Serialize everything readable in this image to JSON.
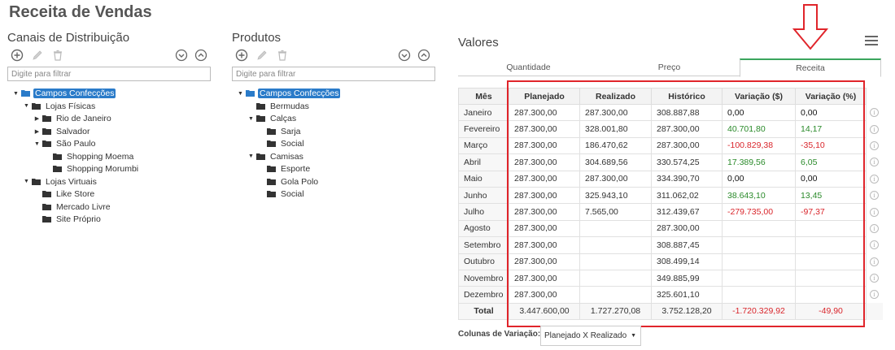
{
  "page_title": "Receita de Vendas",
  "channels": {
    "title": "Canais de Distribuição",
    "filter_placeholder": "Digite para filtrar",
    "tree": [
      {
        "label": "Campos Confecções",
        "depth": 0,
        "expanded": true,
        "selected": true
      },
      {
        "label": "Lojas Físicas",
        "depth": 1,
        "expanded": true
      },
      {
        "label": "Rio de Janeiro",
        "depth": 2,
        "expanded": false
      },
      {
        "label": "Salvador",
        "depth": 2,
        "expanded": false
      },
      {
        "label": "São Paulo",
        "depth": 2,
        "expanded": true
      },
      {
        "label": "Shopping Moema",
        "depth": 3,
        "leaf": true
      },
      {
        "label": "Shopping Morumbi",
        "depth": 3,
        "leaf": true
      },
      {
        "label": "Lojas Virtuais",
        "depth": 1,
        "expanded": true
      },
      {
        "label": "Like Store",
        "depth": 2,
        "leaf": true
      },
      {
        "label": "Mercado Livre",
        "depth": 2,
        "leaf": true
      },
      {
        "label": "Site Próprio",
        "depth": 2,
        "leaf": true
      }
    ]
  },
  "products": {
    "title": "Produtos",
    "filter_placeholder": "Digite para filtrar",
    "tree": [
      {
        "label": "Campos Confecções",
        "depth": 0,
        "expanded": true,
        "selected": true
      },
      {
        "label": "Bermudas",
        "depth": 1,
        "leaf": true
      },
      {
        "label": "Calças",
        "depth": 1,
        "expanded": true
      },
      {
        "label": "Sarja",
        "depth": 2,
        "leaf": true
      },
      {
        "label": "Social",
        "depth": 2,
        "leaf": true
      },
      {
        "label": "Camisas",
        "depth": 1,
        "expanded": true
      },
      {
        "label": "Esporte",
        "depth": 2,
        "leaf": true
      },
      {
        "label": "Gola Polo",
        "depth": 2,
        "leaf": true
      },
      {
        "label": "Social",
        "depth": 2,
        "leaf": true
      }
    ]
  },
  "values": {
    "title": "Valores",
    "tabs": [
      {
        "label": "Quantidade",
        "active": false
      },
      {
        "label": "Preço",
        "active": false
      },
      {
        "label": "Receita",
        "active": true
      }
    ],
    "columns": [
      "Mês",
      "Planejado",
      "Realizado",
      "Histórico",
      "Variação ($)",
      "Variação (%)"
    ],
    "rows": [
      {
        "month": "Janeiro",
        "planned": "287.300,00",
        "realized": "287.300,00",
        "history": "308.887,88",
        "var_abs": "0,00",
        "var_pct": "0,00",
        "sign": "zero"
      },
      {
        "month": "Fevereiro",
        "planned": "287.300,00",
        "realized": "328.001,80",
        "history": "287.300,00",
        "var_abs": "40.701,80",
        "var_pct": "14,17",
        "sign": "pos"
      },
      {
        "month": "Março",
        "planned": "287.300,00",
        "realized": "186.470,62",
        "history": "287.300,00",
        "var_abs": "-100.829,38",
        "var_pct": "-35,10",
        "sign": "neg"
      },
      {
        "month": "Abril",
        "planned": "287.300,00",
        "realized": "304.689,56",
        "history": "330.574,25",
        "var_abs": "17.389,56",
        "var_pct": "6,05",
        "sign": "pos"
      },
      {
        "month": "Maio",
        "planned": "287.300,00",
        "realized": "287.300,00",
        "history": "334.390,70",
        "var_abs": "0,00",
        "var_pct": "0,00",
        "sign": "zero"
      },
      {
        "month": "Junho",
        "planned": "287.300,00",
        "realized": "325.943,10",
        "history": "311.062,02",
        "var_abs": "38.643,10",
        "var_pct": "13,45",
        "sign": "pos"
      },
      {
        "month": "Julho",
        "planned": "287.300,00",
        "realized": "7.565,00",
        "history": "312.439,67",
        "var_abs": "-279.735,00",
        "var_pct": "-97,37",
        "sign": "neg"
      },
      {
        "month": "Agosto",
        "planned": "287.300,00",
        "realized": "",
        "history": "287.300,00",
        "var_abs": "",
        "var_pct": "",
        "sign": "zero"
      },
      {
        "month": "Setembro",
        "planned": "287.300,00",
        "realized": "",
        "history": "308.887,45",
        "var_abs": "",
        "var_pct": "",
        "sign": "zero"
      },
      {
        "month": "Outubro",
        "planned": "287.300,00",
        "realized": "",
        "history": "308.499,14",
        "var_abs": "",
        "var_pct": "",
        "sign": "zero"
      },
      {
        "month": "Novembro",
        "planned": "287.300,00",
        "realized": "",
        "history": "349.885,99",
        "var_abs": "",
        "var_pct": "",
        "sign": "zero"
      },
      {
        "month": "Dezembro",
        "planned": "287.300,00",
        "realized": "",
        "history": "325.601,10",
        "var_abs": "",
        "var_pct": "",
        "sign": "zero"
      }
    ],
    "total": {
      "month": "Total",
      "planned": "3.447.600,00",
      "realized": "1.727.270,08",
      "history": "3.752.128,20",
      "var_abs": "-1.720.329,92",
      "var_pct": "-49,90",
      "sign": "neg"
    },
    "info_icon": "i"
  },
  "variation": {
    "label": "Colunas de Variação:",
    "selected": "Planejado X Realizado"
  },
  "colors": {
    "accent": "#2a7bc9",
    "positive": "#2a8a2a",
    "negative": "#d9252b",
    "highlight": "#e0252b",
    "active_tab": "#3aa55d"
  },
  "icons": [
    "add-icon",
    "edit-icon",
    "delete-icon",
    "collapse-all-icon",
    "expand-all-icon",
    "folder-icon",
    "menu-icon",
    "info-icon",
    "down-arrow-icon"
  ]
}
